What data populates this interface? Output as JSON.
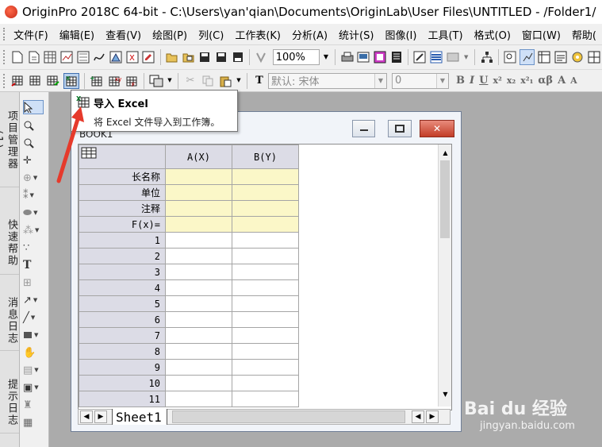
{
  "window": {
    "title": "OriginPro 2018C 64-bit - C:\\Users\\yan'qian\\Documents\\OriginLab\\User Files\\UNTITLED - /Folder1/"
  },
  "menu": [
    "文件(F)",
    "编辑(E)",
    "查看(V)",
    "绘图(P)",
    "列(C)",
    "工作表(K)",
    "分析(A)",
    "统计(S)",
    "图像(I)",
    "工具(T)",
    "格式(O)",
    "窗口(W)",
    "帮助("
  ],
  "toolbar": {
    "zoom_value": "100%",
    "font_value": "默认: 宋体",
    "font_size_value": "0",
    "format_buttons": [
      "B",
      "I",
      "U",
      "x²",
      "x₂",
      "x²₁",
      "αβ",
      "A",
      "A"
    ]
  },
  "side_tabs": [
    "项目管理器 (1)",
    "快速帮助",
    "消息日志",
    "提示日志"
  ],
  "tooltip": {
    "title": "导入 Excel",
    "description": "将 Excel 文件导入到工作簿。"
  },
  "workbook": {
    "title": "BOOK1",
    "columns": [
      "A(X)",
      "B(Y)"
    ],
    "meta_rows": [
      "长名称",
      "单位",
      "注释",
      "F(x)="
    ],
    "row_numbers": [
      "1",
      "2",
      "3",
      "4",
      "5",
      "6",
      "7",
      "8",
      "9",
      "10",
      "11"
    ],
    "sheet_tab": "Sheet1"
  },
  "watermark": {
    "brand": "Bai du 经验",
    "url": "jingyan.baidu.com"
  },
  "colors": {
    "meta_cell": "#fbf7c8",
    "header_cell": "#dcdce6",
    "workspace": "#ababab",
    "close_button": "#c23d27",
    "arrow": "#e63a2b"
  }
}
